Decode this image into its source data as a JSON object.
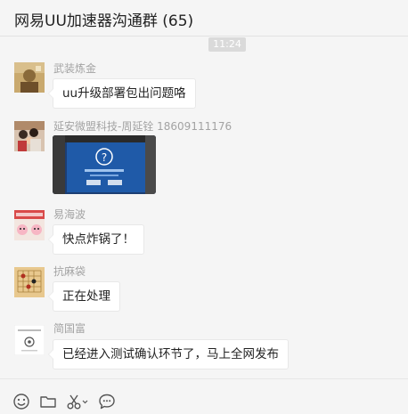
{
  "header": {
    "title": "网易UU加速器沟通群 (65)"
  },
  "timestamp": "11:24",
  "messages": [
    {
      "sender": "武装炼金",
      "text": "uu升级部署包出问题咯",
      "avatar": "avatar-golden-portrait"
    },
    {
      "sender": "延安微盟科技-周延铨 18609111176",
      "image": "screenshot-question-dialog",
      "avatar": "avatar-family-photo"
    },
    {
      "sender": "易海波",
      "text": "快点炸锅了！",
      "avatar": "avatar-cartoon-characters"
    },
    {
      "sender": "抗麻袋",
      "text": "正在处理",
      "avatar": "avatar-chess-board"
    },
    {
      "sender": "简国富",
      "text": "已经进入测试确认环节了，马上全网发布",
      "avatar": "avatar-company-logo"
    }
  ],
  "toolbar": {
    "icons": [
      "emoji-icon",
      "folder-icon",
      "scissors-icon",
      "chat-bubble-icon"
    ]
  },
  "colors": {
    "background": "#f5f5f5",
    "bubble": "#ffffff",
    "sender_text": "#a3a3a3",
    "timestamp_badge": "#dadada"
  }
}
